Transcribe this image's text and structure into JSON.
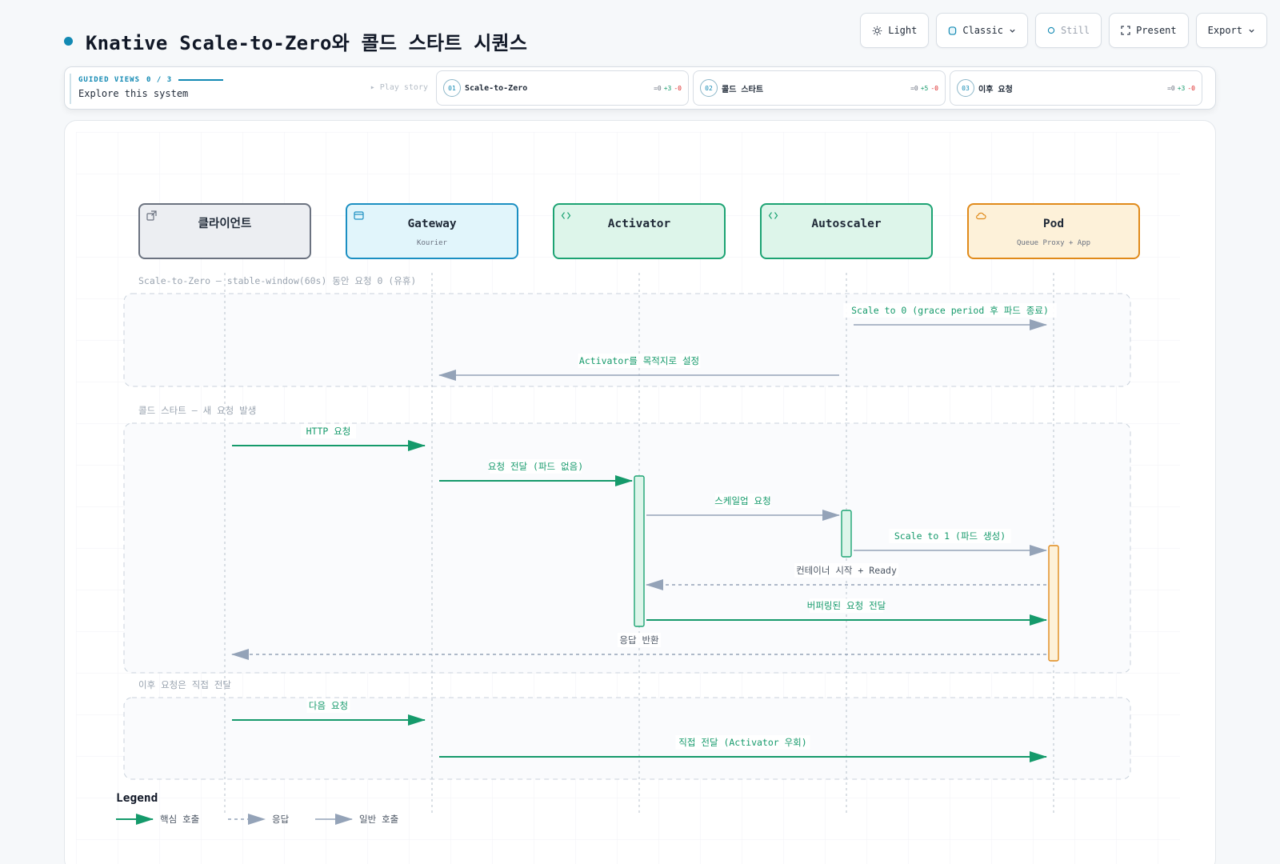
{
  "title": "Knative Scale-to-Zero와 콜드 스타트 시퀀스",
  "toolbar": {
    "light": "Light",
    "classic": "Classic",
    "still": "Still",
    "present": "Present",
    "export": "Export"
  },
  "guided": {
    "kicker": "GUIDED VIEWS",
    "progress": "0 / 3",
    "subtitle": "Explore this system",
    "play": "▸ Play story",
    "views": [
      {
        "num": "01",
        "label": "Scale-to-Zero",
        "eq": "=0",
        "plus": "+3",
        "minus": "-0"
      },
      {
        "num": "02",
        "label": "콜드 스타트",
        "eq": "=0",
        "plus": "+5",
        "minus": "-0"
      },
      {
        "num": "03",
        "label": "이후 요청",
        "eq": "=0",
        "plus": "+3",
        "minus": "-0"
      }
    ]
  },
  "colors": {
    "core": "#159a6b",
    "plain": "#94a3b8",
    "accent": "#1289b3",
    "client": "#6b7280",
    "gateway": "#1b8fc2",
    "service": "#1ca373",
    "pod": "#e08a1a"
  },
  "participants": [
    {
      "id": "client",
      "name": "클라이언트",
      "sub": "",
      "icon": "external-link-icon",
      "kind": "client"
    },
    {
      "id": "gateway",
      "name": "Gateway",
      "sub": "Kourier",
      "icon": "window-icon",
      "kind": "gateway"
    },
    {
      "id": "activator",
      "name": "Activator",
      "sub": "",
      "icon": "code-icon",
      "kind": "service"
    },
    {
      "id": "autoscaler",
      "name": "Autoscaler",
      "sub": "",
      "icon": "code-icon",
      "kind": "service"
    },
    {
      "id": "pod",
      "name": "Pod",
      "sub": "Queue Proxy + App",
      "icon": "cloud-icon",
      "kind": "pod"
    }
  ],
  "groups": [
    {
      "label": "Scale-to-Zero — stable-window(60s) 동안 요청 0 (유휴)"
    },
    {
      "label": "콜드 스타트 — 새 요청 발생"
    },
    {
      "label": "이후 요청은 직접 전달"
    }
  ],
  "messages": [
    {
      "from": "autoscaler",
      "to": "pod",
      "label": "Scale to 0 (grace period 후 파드 종료)",
      "style": "plain",
      "group": 0
    },
    {
      "from": "autoscaler",
      "to": "gateway",
      "label": "Activator를 목적지로 설정",
      "style": "plain",
      "group": 0
    },
    {
      "from": "client",
      "to": "gateway",
      "label": "HTTP 요청",
      "style": "core",
      "group": 1
    },
    {
      "from": "gateway",
      "to": "activator",
      "label": "요청 전달 (파드 없음)",
      "style": "core",
      "group": 1
    },
    {
      "from": "activator",
      "to": "autoscaler",
      "label": "스케일업 요청",
      "style": "plain",
      "group": 1
    },
    {
      "from": "autoscaler",
      "to": "pod",
      "label": "Scale to 1 (파드 생성)",
      "style": "plain",
      "group": 1
    },
    {
      "from": "pod",
      "to": "activator",
      "label": "컨테이너 시작 + Ready",
      "style": "response",
      "group": 1
    },
    {
      "from": "activator",
      "to": "pod",
      "label": "버퍼링된 요청 전달",
      "style": "core",
      "group": 1
    },
    {
      "from": "pod",
      "to": "client",
      "label": "응답 반환",
      "style": "response",
      "group": 1
    },
    {
      "from": "client",
      "to": "gateway",
      "label": "다음 요청",
      "style": "core",
      "group": 2
    },
    {
      "from": "gateway",
      "to": "pod",
      "label": "직접 전달 (Activator 우회)",
      "style": "core",
      "group": 2
    }
  ],
  "activations": [
    {
      "participant": "activator",
      "from_message": 3,
      "to_message": 7,
      "kind": "service"
    },
    {
      "participant": "autoscaler",
      "from_message": 4,
      "to_message": 5,
      "kind": "service"
    },
    {
      "participant": "pod",
      "from_message": 5,
      "to_message": 8,
      "kind": "pod"
    }
  ],
  "legend": {
    "title": "Legend",
    "items": [
      {
        "label": "핵심 호출",
        "style": "core"
      },
      {
        "label": "응답",
        "style": "response"
      },
      {
        "label": "일반 호출",
        "style": "plain"
      }
    ]
  }
}
